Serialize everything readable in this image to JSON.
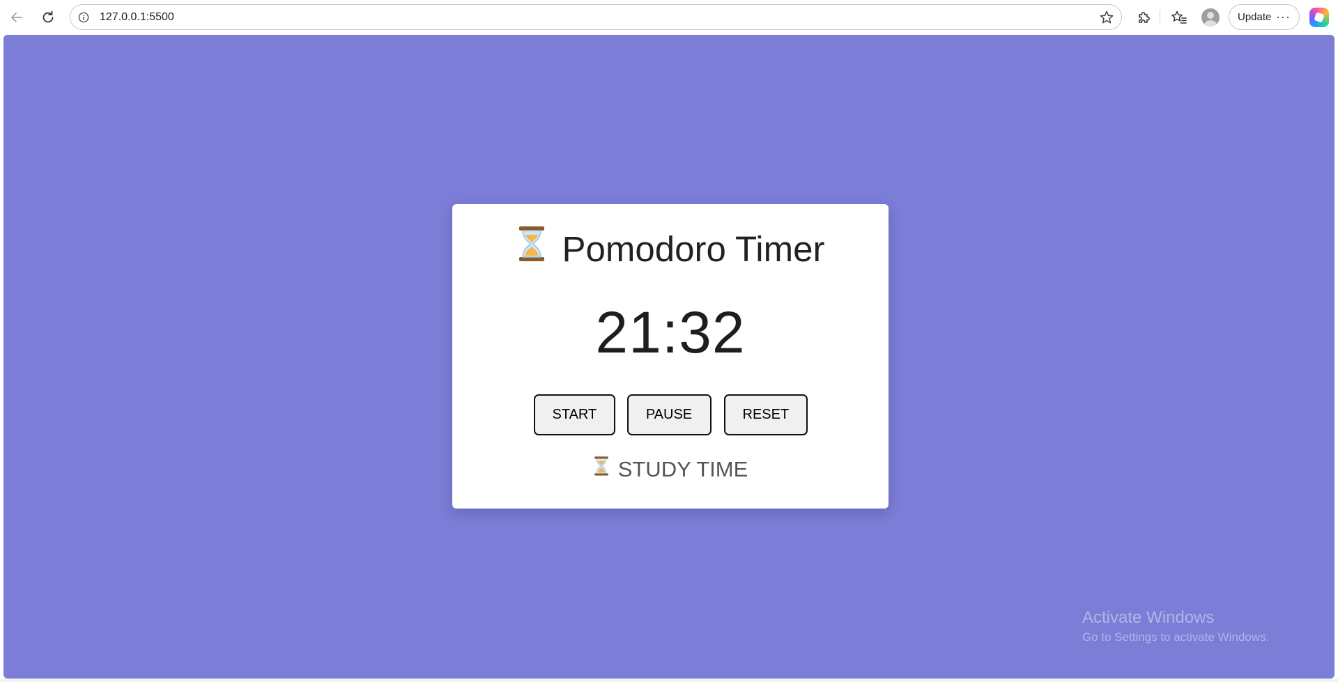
{
  "browser": {
    "url": "127.0.0.1:5500",
    "update_label": "Update",
    "more_label": "···",
    "icons": {
      "back": "back-arrow-icon",
      "reload": "reload-icon",
      "info": "info-icon",
      "favorite": "star-icon",
      "extensions": "puzzle-icon",
      "favorites_list": "favorites-icon",
      "profile": "profile-avatar-icon",
      "copilot": "copilot-icon"
    }
  },
  "page": {
    "background_color": "#7b7dd7",
    "title_icon": "⏳",
    "title": "Pomodoro Timer",
    "time_display": "21:32",
    "buttons": {
      "start": "START",
      "pause": "PAUSE",
      "reset": "RESET"
    },
    "mode_icon": "⏳",
    "mode_label": "STUDY TIME"
  },
  "os_watermark": {
    "line1": "Activate Windows",
    "line2": "Go to Settings to activate Windows."
  }
}
